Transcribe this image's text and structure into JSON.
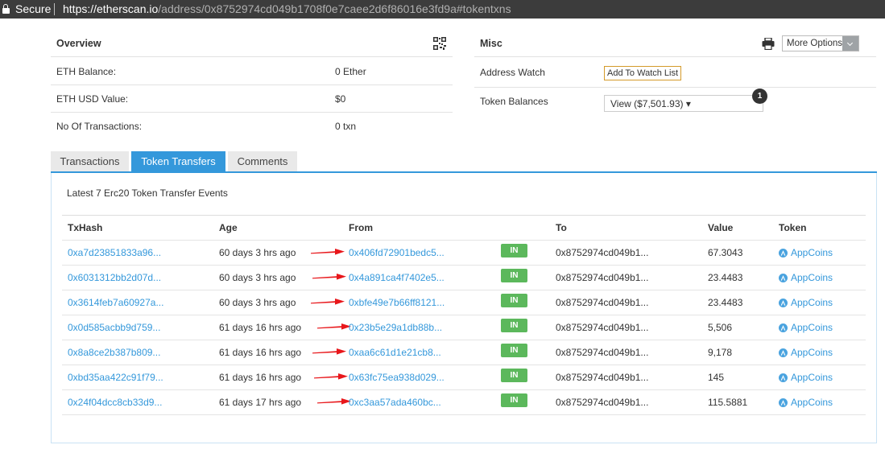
{
  "browser": {
    "secure_label": "Secure",
    "url_host": "https://etherscan.io",
    "url_path": "/address/0x8752974cd049b1708f0e7caee2d6f86016e3fd9a#tokentxns"
  },
  "overview": {
    "title": "Overview",
    "rows": [
      {
        "label": "ETH Balance:",
        "value": "0 Ether"
      },
      {
        "label": "ETH USD Value:",
        "value": "$0"
      },
      {
        "label": "No Of Transactions:",
        "value": "0 txn"
      }
    ]
  },
  "misc": {
    "title": "Misc",
    "more_options_label": "More Options",
    "address_watch_label": "Address Watch",
    "add_to_watch_label": "Add To Watch List",
    "token_balances_label": "Token Balances",
    "token_balances_value": "View ($7,501.93) ▾",
    "token_count_badge": "1"
  },
  "tabs": [
    {
      "label": "Transactions",
      "active": false
    },
    {
      "label": "Token Transfers",
      "active": true
    },
    {
      "label": "Comments",
      "active": false
    }
  ],
  "transfers": {
    "summary": "Latest 7 Erc20 Token Transfer Events",
    "headers": {
      "txhash": "TxHash",
      "age": "Age",
      "from": "From",
      "to": "To",
      "value": "Value",
      "token": "Token"
    },
    "rows": [
      {
        "txhash": "0xa7d23851833a96...",
        "age": "60 days 3 hrs ago",
        "from": "0x406fd72901bedc5...",
        "direction": "IN",
        "to": "0x8752974cd049b1...",
        "value": "67.3043",
        "token": "AppCoins"
      },
      {
        "txhash": "0x6031312bb2d07d...",
        "age": "60 days 3 hrs ago",
        "from": "0x4a891ca4f7402e5...",
        "direction": "IN",
        "to": "0x8752974cd049b1...",
        "value": "23.4483",
        "token": "AppCoins"
      },
      {
        "txhash": "0x3614feb7a60927a...",
        "age": "60 days 3 hrs ago",
        "from": "0xbfe49e7b66ff8121...",
        "direction": "IN",
        "to": "0x8752974cd049b1...",
        "value": "23.4483",
        "token": "AppCoins"
      },
      {
        "txhash": "0x0d585acbb9d759...",
        "age": "61 days 16 hrs ago",
        "from": "0x23b5e29a1db88b...",
        "direction": "IN",
        "to": "0x8752974cd049b1...",
        "value": "5,506",
        "token": "AppCoins"
      },
      {
        "txhash": "0x8a8ce2b387b809...",
        "age": "61 days 16 hrs ago",
        "from": "0xaa6c61d1e21cb8...",
        "direction": "IN",
        "to": "0x8752974cd049b1...",
        "value": "9,178",
        "token": "AppCoins"
      },
      {
        "txhash": "0xbd35aa422c91f79...",
        "age": "61 days 16 hrs ago",
        "from": "0x63fc75ea938d029...",
        "direction": "IN",
        "to": "0x8752974cd049b1...",
        "value": "145",
        "token": "AppCoins"
      },
      {
        "txhash": "0x24f04dcc8cb33d9...",
        "age": "61 days 17 hrs ago",
        "from": "0xc3aa57ada460bc...",
        "direction": "IN",
        "to": "0x8752974cd049b1...",
        "value": "115.5881",
        "token": "AppCoins"
      }
    ]
  },
  "colors": {
    "link": "#3498db",
    "tab_active": "#3498db",
    "in_badge": "#5cb85c",
    "annotation_arrow": "#e8171b",
    "watch_button_border": "#d49a2a"
  },
  "icons": {
    "qr": "qr-code-icon",
    "print": "printer-icon",
    "token": "appcoins-token-icon",
    "annotation": "red-arrow-annotation"
  }
}
